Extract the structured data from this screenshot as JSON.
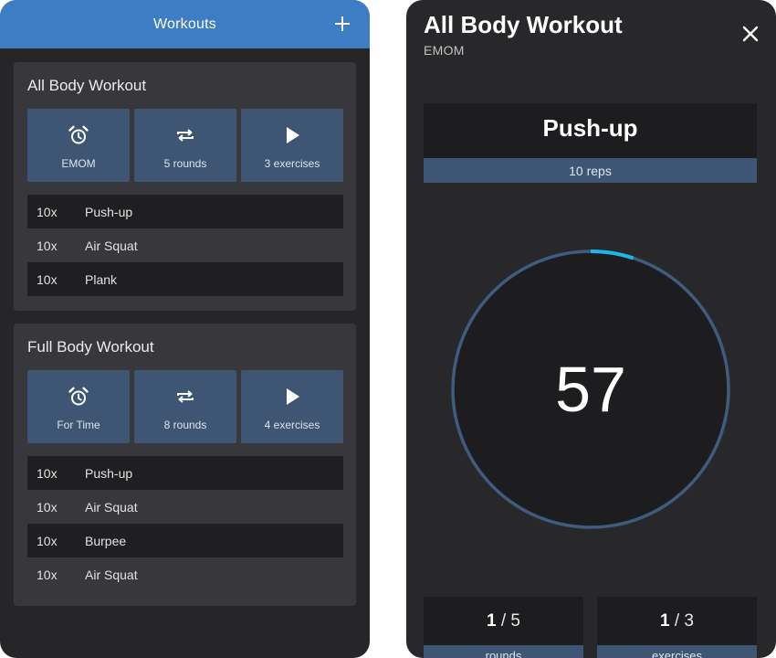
{
  "list_screen": {
    "header": {
      "title": "Workouts",
      "add_icon": "plus-icon"
    },
    "workouts": [
      {
        "title": "All Body Workout",
        "tiles": [
          {
            "icon": "alarm-clock-icon",
            "label": "EMOM"
          },
          {
            "icon": "repeat-icon",
            "label": "5 rounds"
          },
          {
            "icon": "play-icon",
            "label": "3 exercises"
          }
        ],
        "exercises": [
          {
            "reps": "10x",
            "name": "Push-up"
          },
          {
            "reps": "10x",
            "name": "Air Squat"
          },
          {
            "reps": "10x",
            "name": "Plank"
          }
        ]
      },
      {
        "title": "Full Body Workout",
        "tiles": [
          {
            "icon": "alarm-clock-icon",
            "label": "For Time"
          },
          {
            "icon": "repeat-icon",
            "label": "8 rounds"
          },
          {
            "icon": "play-icon",
            "label": "4 exercises"
          }
        ],
        "exercises": [
          {
            "reps": "10x",
            "name": "Push-up"
          },
          {
            "reps": "10x",
            "name": "Air Squat"
          },
          {
            "reps": "10x",
            "name": "Burpee"
          },
          {
            "reps": "10x",
            "name": "Air Squat"
          }
        ]
      }
    ]
  },
  "timer_screen": {
    "title": "All Body Workout",
    "subtitle": "EMOM",
    "close_icon": "close-icon",
    "current_exercise": {
      "name": "Push-up",
      "reps": "10 reps"
    },
    "timer": {
      "value": "57",
      "progress_fraction": 0.05
    },
    "rounds": {
      "current": "1",
      "separator": " / ",
      "total": "5",
      "label": "rounds"
    },
    "exercises": {
      "current": "1",
      "separator": " / ",
      "total": "3",
      "label": "exercises"
    }
  },
  "colors": {
    "appbar": "#3d7dc3",
    "tile": "#3e5673",
    "progress_accent": "#1fb6e6",
    "ring": "#3e5c7e"
  }
}
